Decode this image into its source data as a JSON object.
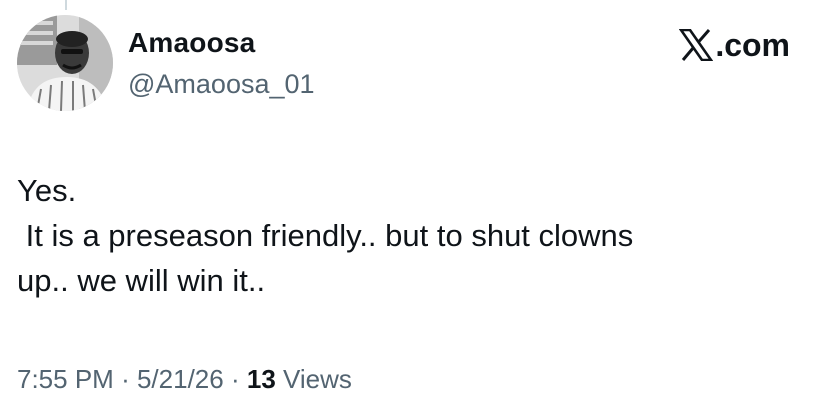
{
  "author": {
    "display_name": "Amaoosa",
    "handle": "@Amaoosa_01",
    "avatar_icon": "profile-photo"
  },
  "brand": {
    "label": ".com",
    "icon": "x-logo-icon"
  },
  "tweet": {
    "lines": [
      "Yes.",
      " It is a preseason friendly.. but to shut clowns",
      "up.. we will win it.."
    ]
  },
  "meta": {
    "time": "7:55 PM",
    "separator": "·",
    "date": "5/21/26",
    "views_count": "13",
    "views_label": "Views"
  },
  "colors": {
    "text_primary": "#0f1419",
    "text_secondary": "#536471",
    "background": "#ffffff"
  }
}
